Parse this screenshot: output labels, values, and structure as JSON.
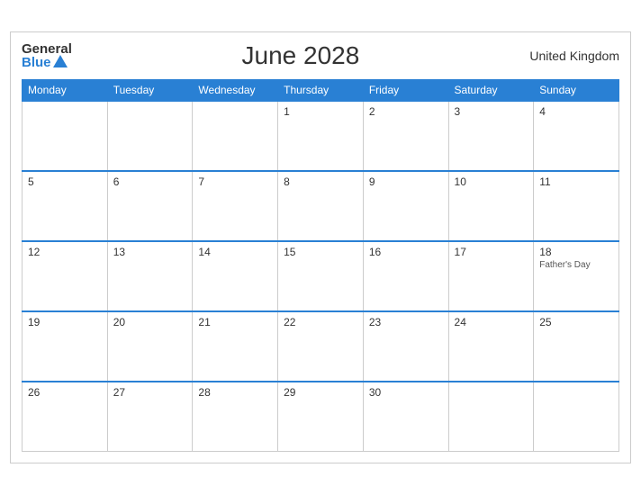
{
  "header": {
    "logo_general": "General",
    "logo_blue": "Blue",
    "title": "June 2028",
    "region": "United Kingdom"
  },
  "weekdays": [
    "Monday",
    "Tuesday",
    "Wednesday",
    "Thursday",
    "Friday",
    "Saturday",
    "Sunday"
  ],
  "weeks": [
    [
      {
        "day": "",
        "empty": true
      },
      {
        "day": "",
        "empty": true
      },
      {
        "day": "",
        "empty": true
      },
      {
        "day": "1",
        "empty": false,
        "event": ""
      },
      {
        "day": "2",
        "empty": false,
        "event": ""
      },
      {
        "day": "3",
        "empty": false,
        "event": ""
      },
      {
        "day": "4",
        "empty": false,
        "event": ""
      }
    ],
    [
      {
        "day": "5",
        "empty": false,
        "event": ""
      },
      {
        "day": "6",
        "empty": false,
        "event": ""
      },
      {
        "day": "7",
        "empty": false,
        "event": ""
      },
      {
        "day": "8",
        "empty": false,
        "event": ""
      },
      {
        "day": "9",
        "empty": false,
        "event": ""
      },
      {
        "day": "10",
        "empty": false,
        "event": ""
      },
      {
        "day": "11",
        "empty": false,
        "event": ""
      }
    ],
    [
      {
        "day": "12",
        "empty": false,
        "event": ""
      },
      {
        "day": "13",
        "empty": false,
        "event": ""
      },
      {
        "day": "14",
        "empty": false,
        "event": ""
      },
      {
        "day": "15",
        "empty": false,
        "event": ""
      },
      {
        "day": "16",
        "empty": false,
        "event": ""
      },
      {
        "day": "17",
        "empty": false,
        "event": ""
      },
      {
        "day": "18",
        "empty": false,
        "event": "Father's Day"
      }
    ],
    [
      {
        "day": "19",
        "empty": false,
        "event": ""
      },
      {
        "day": "20",
        "empty": false,
        "event": ""
      },
      {
        "day": "21",
        "empty": false,
        "event": ""
      },
      {
        "day": "22",
        "empty": false,
        "event": ""
      },
      {
        "day": "23",
        "empty": false,
        "event": ""
      },
      {
        "day": "24",
        "empty": false,
        "event": ""
      },
      {
        "day": "25",
        "empty": false,
        "event": ""
      }
    ],
    [
      {
        "day": "26",
        "empty": false,
        "event": ""
      },
      {
        "day": "27",
        "empty": false,
        "event": ""
      },
      {
        "day": "28",
        "empty": false,
        "event": ""
      },
      {
        "day": "29",
        "empty": false,
        "event": ""
      },
      {
        "day": "30",
        "empty": false,
        "event": ""
      },
      {
        "day": "",
        "empty": true
      },
      {
        "day": "",
        "empty": true
      }
    ]
  ]
}
